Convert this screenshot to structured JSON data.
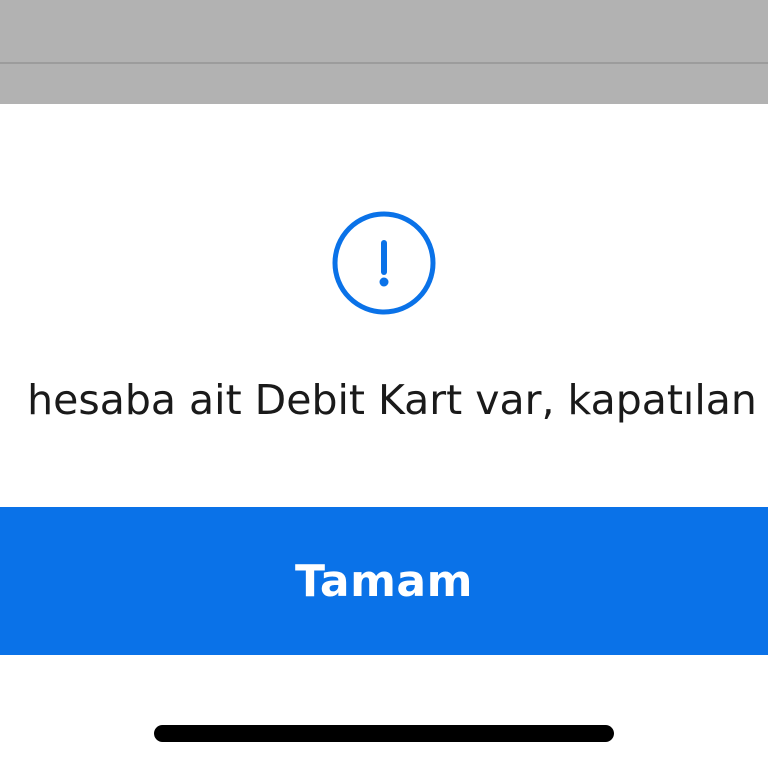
{
  "alert": {
    "icon": "exclamation-circle-icon",
    "message": "hesaba ait Debit Kart var, kapatılan",
    "ok_label": "Tamam"
  },
  "colors": {
    "accent": "#0a72e8",
    "overlay": "#b2b2b2",
    "text": "#1a1a1a"
  }
}
